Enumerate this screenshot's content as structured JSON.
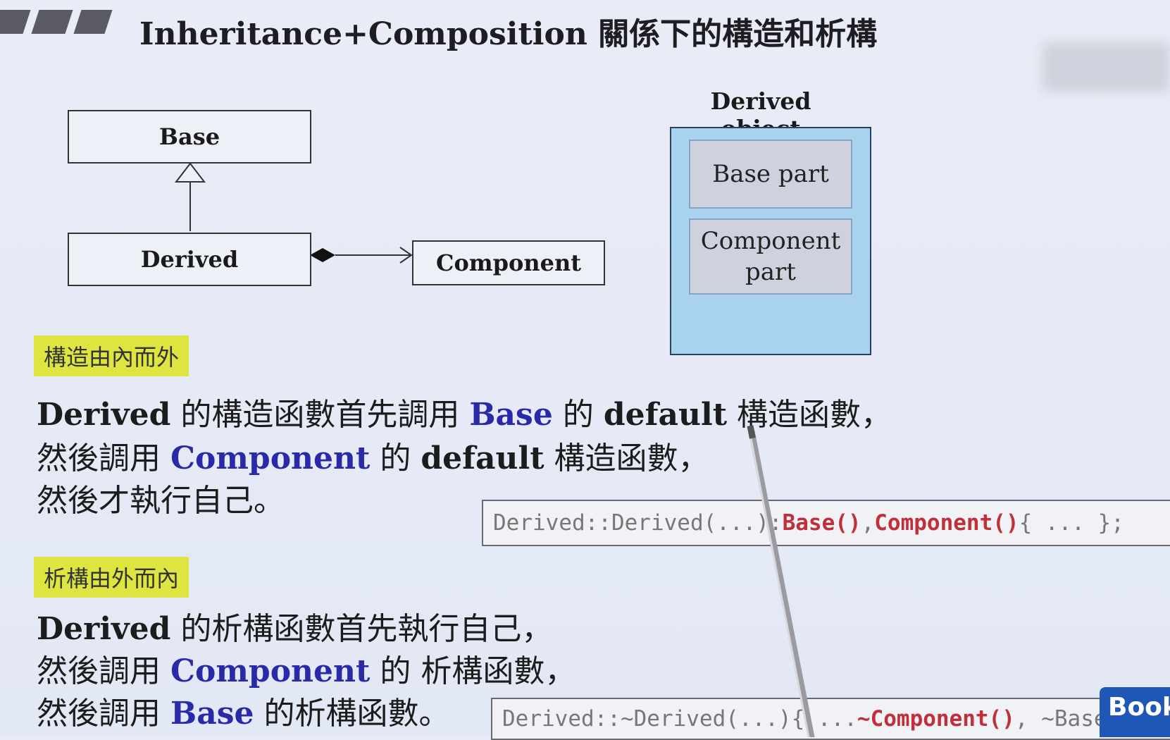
{
  "title": "Inheritance+Composition 關係下的構造和析構",
  "uml": {
    "base": "Base",
    "derived": "Derived",
    "component": "Component"
  },
  "derived_object": {
    "label": "Derived object",
    "base_part": "Base part",
    "component_part_line1": "Component",
    "component_part_line2": "part"
  },
  "construction": {
    "tag": "構造由內而外",
    "line1": {
      "a": "Derived",
      "b": " 的構造函數首先調用 ",
      "c": "Base",
      "d": " 的 ",
      "e": "default",
      "f": " 構造函數，"
    },
    "line2": {
      "a": "然後調用 ",
      "b": "Component",
      "c": " 的 ",
      "d": "default",
      "e": " 構造函數，"
    },
    "line3": "然後才執行自己。",
    "code": {
      "a": "Derived::Derived(...): ",
      "b": "Base()",
      "c": ",",
      "d": "Component()",
      "e": " { ... };"
    }
  },
  "destruction": {
    "tag": "析構由外而內",
    "line1": {
      "a": "Derived",
      "b": " 的析構函數首先執行自己，"
    },
    "line2": {
      "a": "然後調用 ",
      "b": "Component",
      "c": " 的 析構函數，"
    },
    "line3": {
      "a": "然後調用 ",
      "b": "Base",
      "c": " 的析構函數。"
    },
    "code": {
      "a": "Derived::~Derived(...){ ... ",
      "b": "~Component()",
      "c": ", ~Base() };"
    }
  },
  "badge": "Book"
}
